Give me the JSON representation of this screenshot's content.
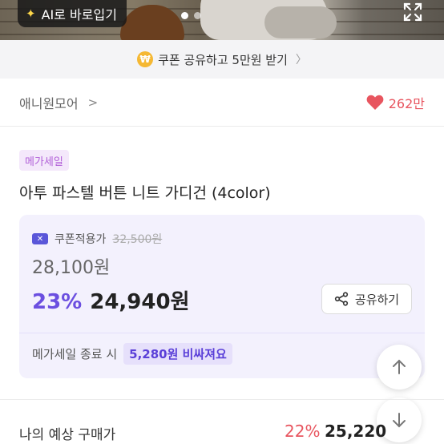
{
  "ai_button": {
    "label": "AI로 바로입기"
  },
  "carousel": {
    "dot_count": 2,
    "active_index": 0
  },
  "share_bar": {
    "text": "쿠폰 공유하고 5만원 받기",
    "coin_symbol": "₩"
  },
  "shop": {
    "name": "애니원모어",
    "likes": "262만"
  },
  "product": {
    "badge": "메가세일",
    "title": "아투 파스텔 버튼 니트 가디건 (4color)"
  },
  "price": {
    "coupon_label": "쿠폰적용가",
    "original": "32,500원",
    "sale": "28,100원",
    "discount_pct": "23%",
    "final": "24,940원",
    "share_label": "공유하기",
    "end_text": "메가세일 종료 시",
    "pricier_text": "5,280원 비싸져요"
  },
  "expected": {
    "label": "나의 예상 구매가",
    "pct": "22%",
    "price": "25,220"
  },
  "colors": {
    "accent_purple": "#6b4fe0",
    "heart_red": "#e8555f",
    "card_bg": "#f3f1fd",
    "badge_text": "#b15fd8"
  }
}
